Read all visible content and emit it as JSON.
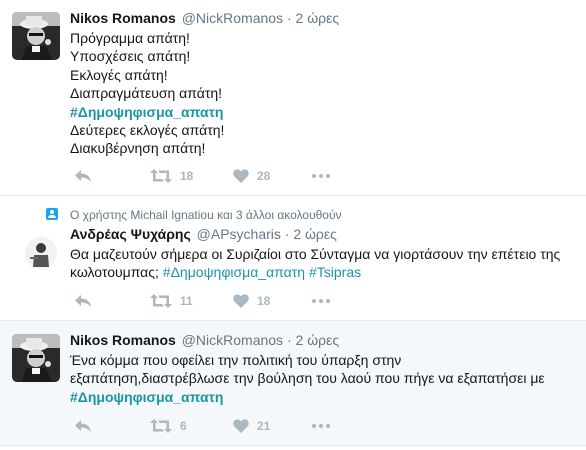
{
  "tweets": [
    {
      "name": "Nikos Romanos",
      "handle": "@NickRomanos",
      "dot": "·",
      "time": "2 ώρες",
      "lines": [
        {
          "text": "Πρόγραμμα απάτη!"
        },
        {
          "text": "Υποσχέσεις απάτη!"
        },
        {
          "text": "Εκλογές απάτη!"
        },
        {
          "text": "Διαπραγμάτευση απάτη!"
        },
        {
          "hashtag": "#Δημοψηφισμα_απατη"
        },
        {
          "text": "Δεύτερες εκλογές απάτη!"
        },
        {
          "text": "Διακυβέρνηση απάτη!"
        }
      ],
      "retweets": "18",
      "likes": "28"
    },
    {
      "context": "Ο χρήστης Michail Ignatiou και 3 άλλοι ακολουθούν",
      "name": "Ανδρέας Ψυχάρης",
      "handle": "@APsycharis",
      "dot": "·",
      "time": "2 ώρες",
      "line1": "Θα μαζευτούν σήμερα οι Συριζαίοι στο Σύνταγμα να γιορτάσουν την επέτειο της",
      "line2_prefix": "κωλοτουμπας;",
      "hashtag1": "#Δημοψηφισμα_απατη",
      "hashtag2": "#Tsipras",
      "retweets": "11",
      "likes": "18"
    },
    {
      "name": "Nikos Romanos",
      "handle": "@NickRomanos",
      "dot": "·",
      "time": "2 ώρες",
      "line1": "Ένα κόμμα που οφείλει την πολιτική του ύπαρξη στην",
      "line2": "εξαπάτηση,διαστρέβλωσε την βούληση του λαού που πήγε να εξαπατήσει με",
      "hashtag": "#Δημοψηφισμα_απατη",
      "retweets": "6",
      "likes": "21"
    }
  ],
  "icons": {
    "reply": "reply-icon",
    "retweet": "retweet-icon",
    "like": "heart-icon",
    "more": "more-dots-icon"
  },
  "colors": {
    "hashtag": "#1b95a5",
    "muted": "#657786",
    "action": "#aab8c2",
    "divider": "#e6ecf0",
    "shaded_bg": "#f5f8fa"
  }
}
